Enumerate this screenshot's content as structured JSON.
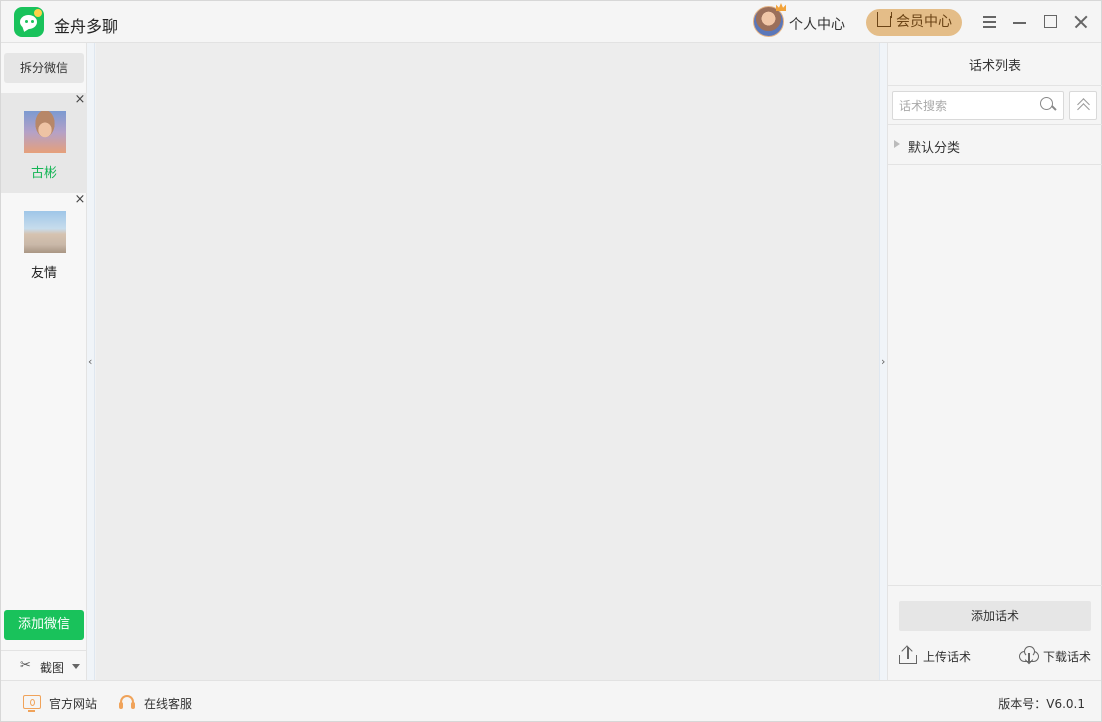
{
  "app": {
    "title": "金舟多聊",
    "logo_icon": "chat-bubble-logo-icon",
    "accent_color": "#19c25b"
  },
  "header": {
    "personal_center": "个人中心",
    "vip_center": "会员中心",
    "vip_color": "#e4bd88",
    "controls": [
      "menu-icon",
      "minimize-icon",
      "maximize-icon",
      "close-icon"
    ]
  },
  "sidebar": {
    "split_button": "拆分微信",
    "accounts": [
      {
        "name": "古彬",
        "active": true,
        "close": "×"
      },
      {
        "name": "友情",
        "active": false,
        "close": "×"
      }
    ],
    "add_button": "添加微信",
    "screenshot_label": "截图"
  },
  "right_panel": {
    "title": "话术列表",
    "search_placeholder": "话术搜索",
    "categories": [
      {
        "label": "默认分类"
      }
    ],
    "add_button": "添加话术",
    "upload_label": "上传话术",
    "download_label": "下载话术"
  },
  "statusbar": {
    "website": "官方网站",
    "service": "在线客服",
    "version": "版本号：V6.0.1"
  }
}
